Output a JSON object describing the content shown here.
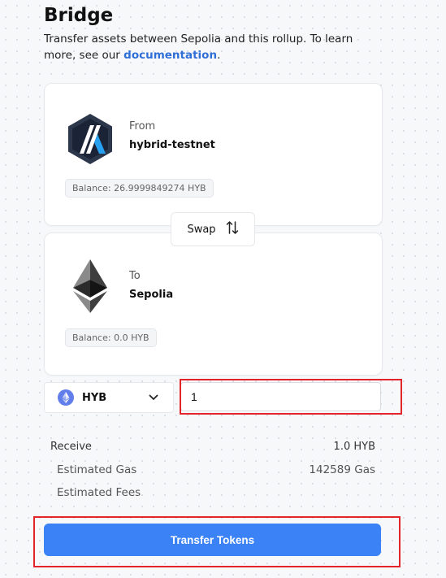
{
  "header": {
    "title": "Bridge",
    "subtitle_prefix": "Transfer assets between Sepolia and this rollup. To learn more, see our ",
    "doc_link": "documentation",
    "subtitle_suffix": "."
  },
  "from": {
    "label": "From",
    "network": "hybrid-testnet",
    "balance": "Balance: 26.9999849274 HYB",
    "icon": "arbitrum-logo"
  },
  "swap": {
    "label": "Swap",
    "icon": "swap-arrows-icon"
  },
  "to": {
    "label": "To",
    "network": "Sepolia",
    "balance": "Balance: 0.0 HYB",
    "icon": "ethereum-logo"
  },
  "token": {
    "selected": "HYB",
    "icon": "ethereum-icon"
  },
  "amount": {
    "value": "1"
  },
  "summary": {
    "receive_label": "Receive",
    "receive_value": "1.0 HYB",
    "gas_label": "Estimated Gas",
    "gas_value": "142589 Gas",
    "fees_label": "Estimated Fees",
    "fees_value": ""
  },
  "actions": {
    "transfer_label": "Transfer Tokens"
  },
  "colors": {
    "accent": "#3b82f6",
    "link": "#2f6fd6",
    "highlight": "#e3242b"
  }
}
